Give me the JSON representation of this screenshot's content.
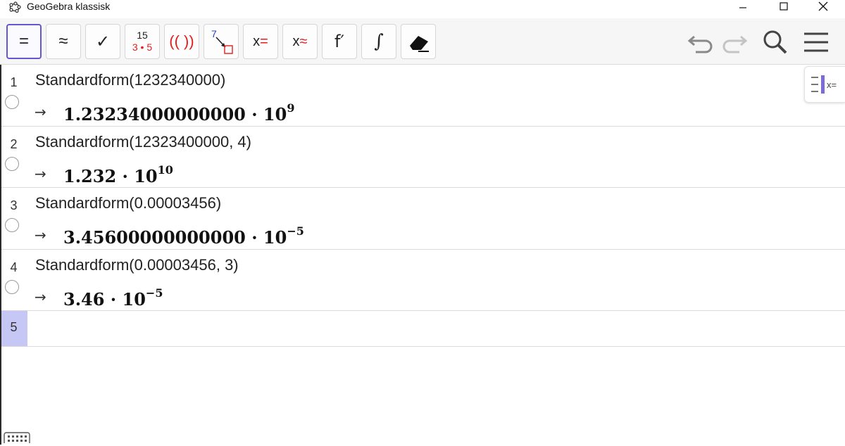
{
  "window": {
    "title": "GeoGebra klassisk",
    "controls": [
      "minimize",
      "maximize",
      "close"
    ]
  },
  "toolbar": {
    "tools": [
      {
        "name": "symbolic-equals",
        "label": "=",
        "active": true
      },
      {
        "name": "numeric-approx",
        "label": "≈"
      },
      {
        "name": "check-input",
        "label": "✓"
      },
      {
        "name": "factor-number",
        "label_top": "15",
        "label_bottom": "3 • 5"
      },
      {
        "name": "expand",
        "label": "(( ))"
      },
      {
        "name": "substitute",
        "label": "7"
      },
      {
        "name": "solve",
        "label": "x="
      },
      {
        "name": "solve-numerically",
        "label": "x≈"
      },
      {
        "name": "derivative",
        "label": "f′"
      },
      {
        "name": "integral",
        "label": "∫"
      },
      {
        "name": "eraser",
        "label": ""
      }
    ],
    "right": [
      "undo",
      "redo",
      "search",
      "menu"
    ]
  },
  "algebra": {
    "rows": [
      {
        "index": "1",
        "input": "Standardform(1232340000)",
        "arrow": "→",
        "mantissa": "1.23234000000000 · 10",
        "exponent": "9"
      },
      {
        "index": "2",
        "input": "Standardform(12323400000, 4)",
        "arrow": "→",
        "mantissa": "1.232 · 10",
        "exponent": "10"
      },
      {
        "index": "3",
        "input": "Standardform(0.00003456)",
        "arrow": "→",
        "mantissa": "3.45600000000000 · 10",
        "exponent": "−5"
      },
      {
        "index": "4",
        "input": "Standardform(0.00003456, 3)",
        "arrow": "→",
        "mantissa": "3.46 · 10",
        "exponent": "−5"
      }
    ],
    "new_row": {
      "index": "5",
      "input": ""
    }
  },
  "panel_toggle": {
    "label": "x="
  },
  "colors": {
    "accent": "#6557d2",
    "active_row": "#c7c7f6",
    "tool_red": "#e02020",
    "tool_blue": "#2040d0"
  }
}
